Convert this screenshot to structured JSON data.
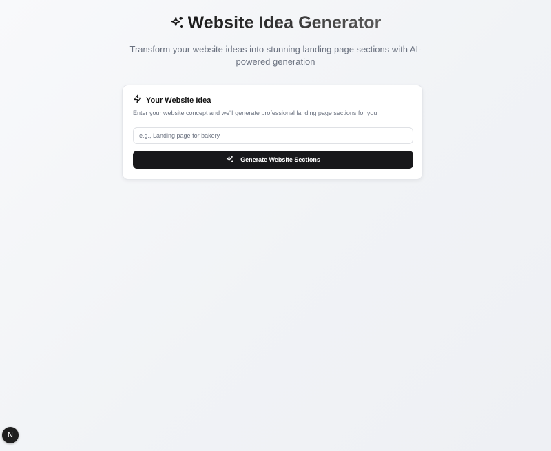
{
  "header": {
    "title": "Website Idea Generator",
    "title_icon": "sparkles-icon",
    "subtitle": "Transform your website ideas into stunning landing page sections with AI-powered generation"
  },
  "card": {
    "icon": "lightning-icon",
    "title": "Your Website Idea",
    "description": "Enter your website concept and we'll generate professional landing page sections for you",
    "input": {
      "value": "",
      "placeholder": "e.g., Landing page for bakery"
    },
    "button": {
      "icon": "sparkles-icon",
      "label": "Generate Website Sections"
    }
  },
  "dev_badge": {
    "icon": "nextjs-logo-icon",
    "letter": "N"
  },
  "colors": {
    "button_bg": "#18181b",
    "title_dark": "#1a1a1a",
    "subtitle": "#6b7280"
  }
}
